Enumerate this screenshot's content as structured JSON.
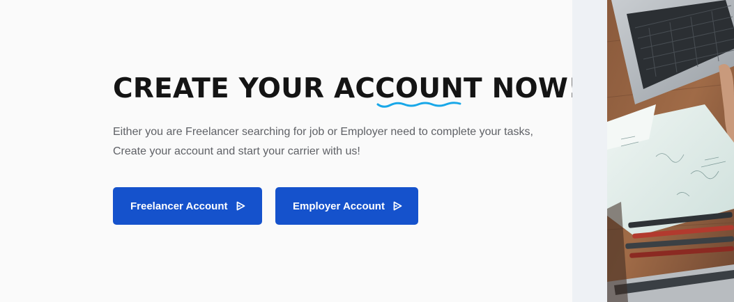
{
  "hero": {
    "title": "CREATE YOUR ACCOUNT NOW!",
    "intro_line1": "Either you are Freelancer searching for job or Employer need to complete your tasks,",
    "intro_line2": "Create your account and start your carrier with us!"
  },
  "buttons": {
    "freelancer_label": "Freelancer Account",
    "employer_label": "Employer Account",
    "arrow_icon": "play-outline-icon"
  },
  "colors": {
    "background": "#fafafa",
    "side_strip": "#eef1f5",
    "title": "#141414",
    "underline_accent": "#18a7e8",
    "body_text": "#5f6166",
    "button": "#1552cc",
    "button_text": "#ffffff"
  },
  "image": {
    "subject": "laptop-and-paperwork-photo"
  }
}
